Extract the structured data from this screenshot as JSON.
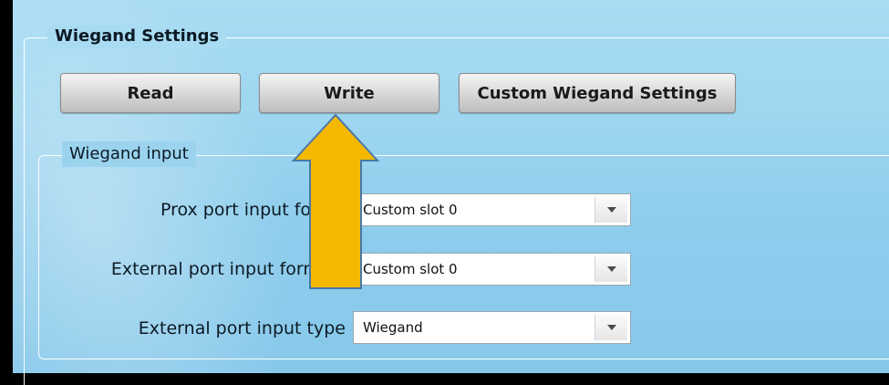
{
  "settings_group": {
    "title": "Wiegand Settings"
  },
  "toolbar": {
    "read_label": "Read",
    "write_label": "Write",
    "custom_label": "Custom Wiegand Settings"
  },
  "input_group": {
    "title": "Wiegand input",
    "rows": [
      {
        "label": "Prox port input form",
        "value": "Custom slot 0"
      },
      {
        "label": "External port input format",
        "value": "Custom slot 0"
      },
      {
        "label": "External port input type",
        "value": "Wiegand"
      }
    ]
  },
  "annotation": {
    "icon": "up-arrow-icon",
    "color": "#f5b800"
  }
}
